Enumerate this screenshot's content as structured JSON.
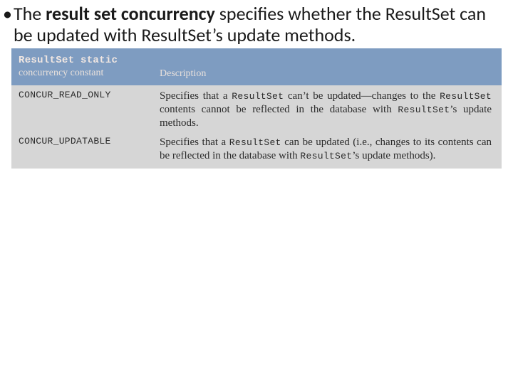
{
  "bullet": {
    "pre": "The ",
    "bold": "result set concurrency",
    "post": " specifies whether the ResultSet can be updated with ResultSet’s update methods."
  },
  "table": {
    "header": {
      "col1_line1": "ResultSet static",
      "col1_line2": "concurrency constant",
      "col2": "Description"
    },
    "rows": [
      {
        "constant": "CONCUR_READ_ONLY",
        "desc_pre": "Specifies that a ",
        "desc_code1": "ResultSet",
        "desc_mid1": " can’t be updated—changes to the ",
        "desc_code2": "ResultSet",
        "desc_mid2": " contents cannot be reflected in the database with ",
        "desc_code3": "ResultSet",
        "desc_post": "’s update methods."
      },
      {
        "constant": "CONCUR_UPDATABLE",
        "desc_pre": "Specifies that a ",
        "desc_code1": "ResultSet",
        "desc_mid1": " can be updated (i.e., changes to its contents can be reflected in the database with ",
        "desc_code2": "ResultSet",
        "desc_mid2": "",
        "desc_code3": "",
        "desc_post": "’s update methods)."
      }
    ]
  }
}
